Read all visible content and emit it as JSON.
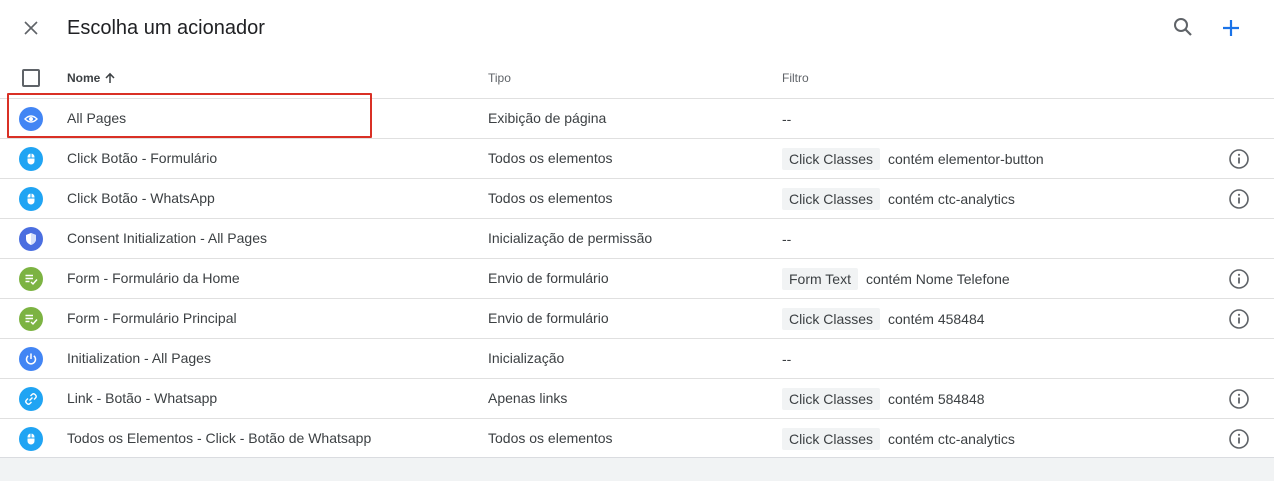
{
  "header": {
    "title": "Escolha um acionador",
    "close_icon": "close-icon",
    "search_icon": "search-icon",
    "add_icon": "add-icon",
    "accent_color": "#1a73e8"
  },
  "table": {
    "columns": {
      "name": "Nome",
      "tipo": "Tipo",
      "filtro": "Filtro"
    },
    "sort_icon": "arrow-up-icon",
    "rows": [
      {
        "icon": "eye-icon",
        "icon_color": "#4285f4",
        "name": "All Pages",
        "tipo": "Exibição de página",
        "filter_dash": "--",
        "info": false
      },
      {
        "icon": "mouse-icon",
        "icon_color": "#20a4f3",
        "name": "Click Botão - Formulário",
        "tipo": "Todos os elementos",
        "filter_var": "Click Classes",
        "filter_cond": "contém elementor-button",
        "info": true
      },
      {
        "icon": "mouse-icon",
        "icon_color": "#20a4f3",
        "name": "Click Botão - WhatsApp",
        "tipo": "Todos os elementos",
        "filter_var": "Click Classes",
        "filter_cond": "contém ctc-analytics",
        "info": true
      },
      {
        "icon": "shield-icon",
        "icon_color": "#4a6ee0",
        "name": "Consent Initialization - All Pages",
        "tipo": "Inicialização de permissão",
        "filter_dash": "--",
        "info": false
      },
      {
        "icon": "form-icon",
        "icon_color": "#7cb342",
        "name": "Form - Formulário da Home",
        "tipo": "Envio de formulário",
        "filter_var": "Form Text",
        "filter_cond": "contém Nome Telefone",
        "info": true
      },
      {
        "icon": "form-icon",
        "icon_color": "#7cb342",
        "name": "Form - Formulário Principal",
        "tipo": "Envio de formulário",
        "filter_var": "Click Classes",
        "filter_cond": "contém 458484",
        "info": true
      },
      {
        "icon": "power-icon",
        "icon_color": "#4285f4",
        "name": "Initialization - All Pages",
        "tipo": "Inicialização",
        "filter_dash": "--",
        "info": false
      },
      {
        "icon": "link-icon",
        "icon_color": "#20a4f3",
        "name": "Link - Botão - Whatsapp",
        "tipo": "Apenas links",
        "filter_var": "Click Classes",
        "filter_cond": "contém 584848",
        "info": true
      },
      {
        "icon": "mouse-icon",
        "icon_color": "#20a4f3",
        "name": "Todos os Elementos - Click - Botão de Whatsapp",
        "tipo": "Todos os elementos",
        "filter_var": "Click Classes",
        "filter_cond": "contém ctc-analytics",
        "info": true
      }
    ]
  },
  "highlight_color": "#d93025"
}
